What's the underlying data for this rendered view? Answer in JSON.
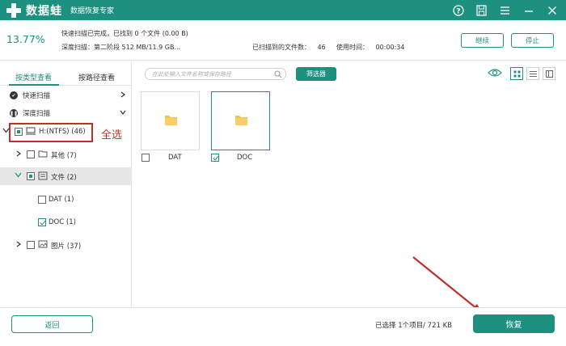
{
  "app": {
    "name": "数据蛙",
    "subtitle": "数据恢复专家"
  },
  "scan": {
    "percent": "13.77%",
    "quick_status": "快速扫描已完成，已找到 0 个文件 (0.00  B)",
    "deep_status": "深度扫描：第二阶段 512 MB/11.9 GB...",
    "found_label": "已扫描到的文件数：",
    "found_value": "46",
    "time_label": "使用时间：",
    "time_value": "00:00:34",
    "continue_label": "继续",
    "stop_label": "停止"
  },
  "tabs": {
    "by_type": "按类型查看",
    "by_path": "按路径查看"
  },
  "tree": {
    "quick_scan": "快速扫描",
    "deep_scan": "深度扫描",
    "drive": "H:(NTFS) (46)",
    "other": "其他 (7)",
    "docs": "文件 (2)",
    "dat": "DAT (1)",
    "doc": "DOC (1)",
    "pics": "图片 (37)"
  },
  "search": {
    "placeholder": "在此处输入文件名称或保存路径"
  },
  "filter_label": "筛选器",
  "files": [
    {
      "name": "DAT",
      "checked": false
    },
    {
      "name": "DOC",
      "checked": true
    }
  ],
  "annotation": {
    "select_all": "全选"
  },
  "footer": {
    "back_label": "返回",
    "selection": "已选择 1个项目/ 721 KB",
    "recover_label": "恢复"
  },
  "colors": {
    "brand": "#1d9080",
    "annotation": "#c0302a"
  }
}
